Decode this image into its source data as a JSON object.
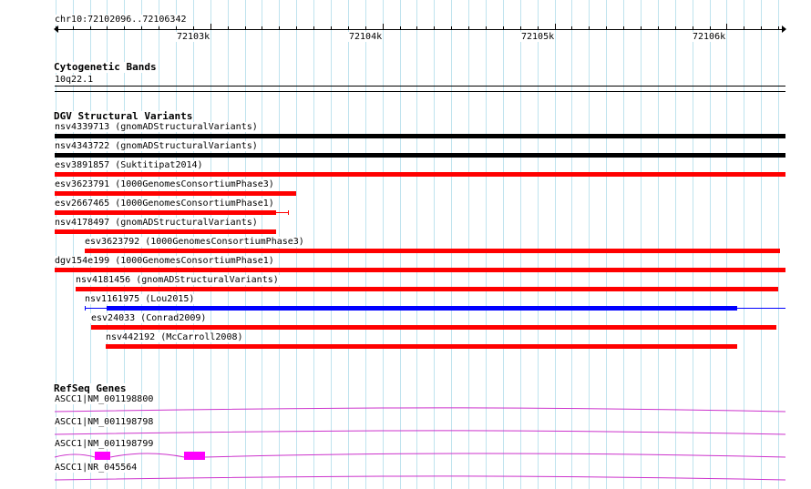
{
  "region": "chr10:72102096..72106342",
  "ruler": {
    "start": 72102096,
    "end": 72106342,
    "tick_labels": [
      {
        "pos": 72103000,
        "label": "72103k"
      },
      {
        "pos": 72104000,
        "label": "72104k"
      },
      {
        "pos": 72105000,
        "label": "72105k"
      },
      {
        "pos": 72106000,
        "label": "72106k"
      }
    ]
  },
  "tracks": {
    "cytoband": {
      "title": "Cytogenetic Bands",
      "band": "10q22.1"
    },
    "dgv": {
      "title": "DGV Structural Variants",
      "items": [
        {
          "id": "nsv4339713",
          "label": "nsv4339713 (gnomADStructuralVariants)",
          "start": 72102096,
          "end": 72106342,
          "color": "#000000"
        },
        {
          "id": "nsv4343722",
          "label": "nsv4343722 (gnomADStructuralVariants)",
          "start": 72102096,
          "end": 72106342,
          "color": "#000000"
        },
        {
          "id": "esv3891857",
          "label": "esv3891857 (Suktitipat2014)",
          "start": 72102096,
          "end": 72106342,
          "color": "#ff0000"
        },
        {
          "id": "esv3623791",
          "label": "esv3623791 (1000GenomesConsortiumPhase3)",
          "start": 72102096,
          "end": 72103500,
          "color": "#ff0000"
        },
        {
          "id": "esv2667465",
          "label": "esv2667465 (1000GenomesConsortiumPhase1)",
          "start": 72102096,
          "end": 72103380,
          "color": "#ff0000",
          "thin_to": 72103450
        },
        {
          "id": "nsv4178497",
          "label": "nsv4178497 (gnomADStructuralVariants)",
          "start": 72102096,
          "end": 72103380,
          "color": "#ff0000"
        },
        {
          "id": "esv3623792",
          "label": "esv3623792 (1000GenomesConsortiumPhase3)",
          "start": 72102270,
          "end": 72106310,
          "color": "#ff0000"
        },
        {
          "id": "dgv154e199",
          "label": "dgv154e199 (1000GenomesConsortiumPhase1)",
          "start": 72102096,
          "end": 72106342,
          "color": "#ff0000"
        },
        {
          "id": "nsv4181456",
          "label": "nsv4181456 (gnomADStructuralVariants)",
          "start": 72102220,
          "end": 72106300,
          "color": "#ff0000"
        },
        {
          "id": "nsv1161975",
          "label": "nsv1161975 (Lou2015)",
          "start": 72102400,
          "end": 72106060,
          "color": "#0000ff",
          "thin_from": 72102270,
          "thin_to": 72106342
        },
        {
          "id": "esv24033",
          "label": "esv24033 (Conrad2009)",
          "start": 72102310,
          "end": 72106290,
          "color": "#ff0000"
        },
        {
          "id": "nsv442192",
          "label": "nsv442192 (McCarroll2008)",
          "start": 72102390,
          "end": 72106060,
          "color": "#ff0000"
        }
      ]
    },
    "refseq": {
      "title": "RefSeq Genes",
      "color": "#cc33cc",
      "exon_color": "#ff00ff",
      "items": [
        {
          "label": "ASCC1|NM_001198800",
          "exons": []
        },
        {
          "label": "ASCC1|NM_001198798",
          "exons": []
        },
        {
          "label": "ASCC1|NM_001198799",
          "exons": [
            {
              "start": 72102330,
              "end": 72102420
            },
            {
              "start": 72102850,
              "end": 72102970
            }
          ]
        },
        {
          "label": "ASCC1|NR_045564",
          "exons": []
        }
      ]
    }
  },
  "colors": {
    "grid": "#bfe3ee",
    "background": "#ffffff"
  }
}
